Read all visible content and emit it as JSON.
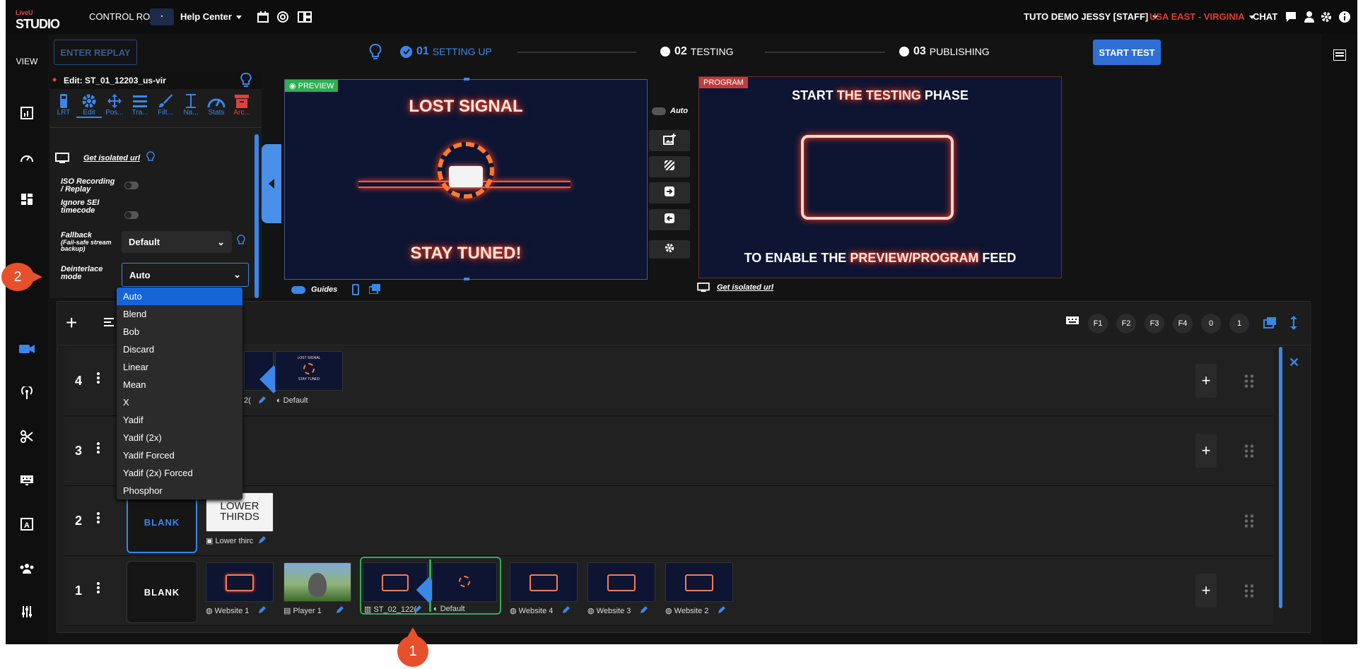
{
  "header": {
    "logo_top": "LiveU",
    "logo_main": "STUDIO",
    "control_rooms": "CONTROL ROOMS",
    "help_center": "Help Center",
    "user": "TUTO DEMO JESSY [STAFF]",
    "region": "USA EAST - VIRGINIA",
    "chat": "CHAT",
    "region_color": "#e53a2f"
  },
  "leftnav": {
    "view_label": "VIEW"
  },
  "toolbar": {
    "enter_replay": "ENTER REPLAY",
    "start_test": "START TEST"
  },
  "steps": [
    {
      "num": "01",
      "label": "SETTING UP"
    },
    {
      "num": "02",
      "label": "TESTING"
    },
    {
      "num": "03",
      "label": "PUBLISHING"
    }
  ],
  "edit_panel": {
    "title": "Edit: ST_01_12203_us-vir",
    "tools": [
      "LRT",
      "Edit",
      "Pos...",
      "Tra...",
      "Filt...",
      "Na...",
      "Stats",
      "Arc..."
    ],
    "isolated_url": "Get isolated url",
    "iso_recording": "ISO Recording / Replay",
    "ignore_sei": "Ignore SEI timecode",
    "fallback_label": "Fallback",
    "fallback_sub": "(Fail-safe stream backup)",
    "fallback_value": "Default",
    "deinterlace_label": "Deinterlace mode",
    "deinterlace_value": "Auto"
  },
  "deinterlace_options": [
    "Auto",
    "Blend",
    "Bob",
    "Discard",
    "Linear",
    "Mean",
    "X",
    "Yadif",
    "Yadif (2x)",
    "Yadif Forced",
    "Yadif (2x) Forced",
    "Phosphor"
  ],
  "preview": {
    "tag": "PREVIEW",
    "line1": "LOST SIGNAL",
    "line2": "STAY TUNED!",
    "guides": "Guides"
  },
  "controls": {
    "auto": "Auto"
  },
  "program": {
    "tag": "PROGRAM",
    "top_a": "START ",
    "top_b": "THE TESTING",
    "top_c": " PHASE",
    "bot_a": "TO ENABLE THE ",
    "bot_b": "PREVIEW/PROGRAM",
    "bot_c": " FEED",
    "isolated_url": "Get isolated url"
  },
  "layers_bar": {
    "fkeys": [
      "F1",
      "F2",
      "F3",
      "F4",
      "0",
      "1"
    ]
  },
  "layers": {
    "row4": {
      "num": "4",
      "label_a": "2(",
      "label_b": "Default",
      "thumb_text1": "LOST SIGNAL",
      "thumb_text2": "STAY TUNED"
    },
    "row3": {
      "num": "3"
    },
    "row2": {
      "num": "2",
      "blank": "BLANK",
      "lt_line1": "LOWER",
      "lt_line2": "THIRDS",
      "lt_label": "Lower thirc"
    },
    "row1": {
      "num": "1",
      "blank": "BLANK",
      "items": [
        "Website 1",
        "Player 1",
        "ST_02_122(",
        "Default",
        "Website 4",
        "Website 3",
        "Website 2"
      ]
    }
  },
  "callouts": [
    "1",
    "2"
  ],
  "colors": {
    "accent": "#3b86e8",
    "callout": "#e8502b",
    "program": "#c43a3a",
    "preview": "#2fae52"
  }
}
